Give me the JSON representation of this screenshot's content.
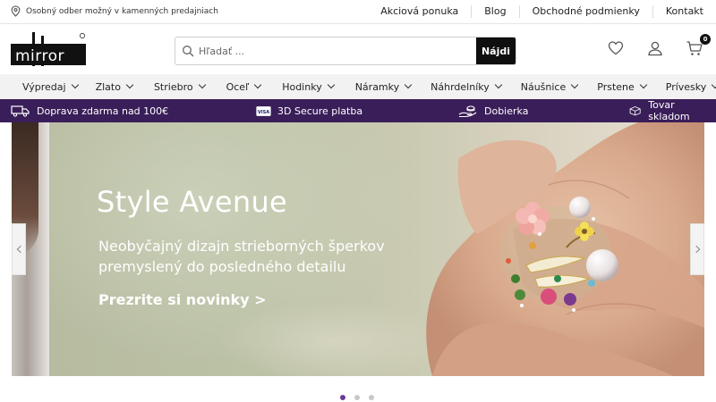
{
  "topbar": {
    "pickup_text": "Osobný odber možný v kamenných predajniach",
    "links": [
      "Akciová ponuka",
      "Blog",
      "Obchodné podmienky",
      "Kontakt"
    ]
  },
  "header": {
    "logo_text": "mirror",
    "search_placeholder": "Hľadať ...",
    "search_button": "Nájdi",
    "cart_count": "0"
  },
  "nav": {
    "categories": [
      "Výpredaj",
      "Zlato",
      "Striebro",
      "Oceľ",
      "Hodinky",
      "Náramky",
      "Náhrdelníky",
      "Náušnice",
      "Prstene",
      "Prívesky"
    ]
  },
  "benefits": {
    "shipping": "Doprava zdarma nad 100€",
    "secure": "3D Secure platba",
    "cod": "Dobierka",
    "stock": "Tovar skladom",
    "visa_badge": "VISA"
  },
  "hero": {
    "title": "Style Avenue",
    "subtitle": "Neobyčajný dizajn strieborných šperkov premyslený do posledného detailu",
    "cta": "Prezrite si novinky >"
  },
  "slider": {
    "active_index": 0,
    "count": 3
  },
  "colors": {
    "brand_purple": "#3a1e59",
    "dot_active": "#6a3a9a",
    "search_button": "#0f0f0f"
  }
}
